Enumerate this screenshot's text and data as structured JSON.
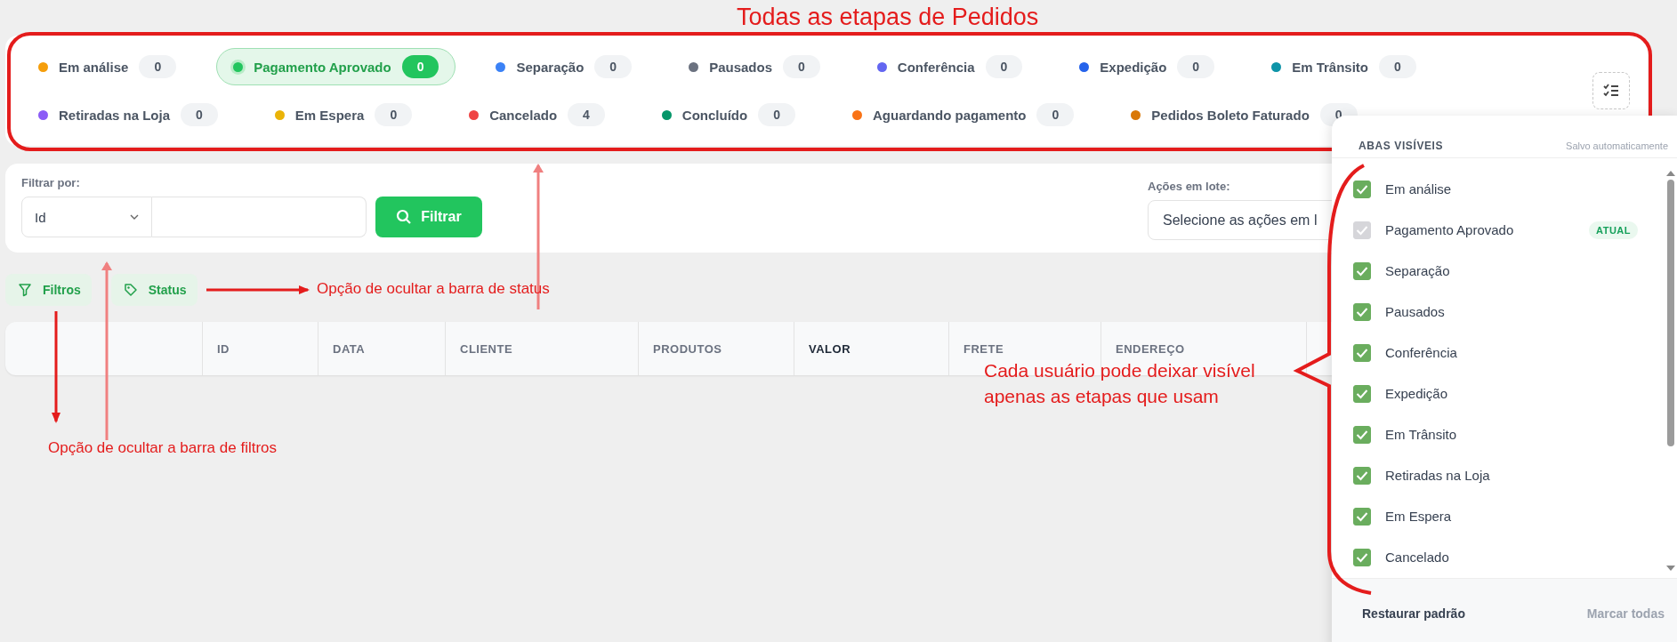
{
  "status_tabs": [
    {
      "label": "Em análise",
      "count": "0",
      "color": "#f59e0b",
      "selected": false
    },
    {
      "label": "Pagamento Aprovado",
      "count": "0",
      "color": "#22c55e",
      "selected": true
    },
    {
      "label": "Separação",
      "count": "0",
      "color": "#3b82f6",
      "selected": false
    },
    {
      "label": "Pausados",
      "count": "0",
      "color": "#6b7280",
      "selected": false
    },
    {
      "label": "Conferência",
      "count": "0",
      "color": "#6366f1",
      "selected": false
    },
    {
      "label": "Expedição",
      "count": "0",
      "color": "#2563eb",
      "selected": false
    },
    {
      "label": "Em Trânsito",
      "count": "0",
      "color": "#0e94a8",
      "selected": false
    },
    {
      "label": "Retiradas na Loja",
      "count": "0",
      "color": "#8b5cf6",
      "selected": false
    },
    {
      "label": "Em Espera",
      "count": "0",
      "color": "#eab308",
      "selected": false
    },
    {
      "label": "Cancelado",
      "count": "4",
      "color": "#ef4444",
      "selected": false
    },
    {
      "label": "Concluído",
      "count": "0",
      "color": "#059669",
      "selected": false
    },
    {
      "label": "Aguardando pagamento",
      "count": "0",
      "color": "#f97316",
      "selected": false
    },
    {
      "label": "Pedidos Boleto Faturado",
      "count": "0",
      "color": "#d97706",
      "selected": false
    }
  ],
  "filter": {
    "label": "Filtrar por:",
    "field_select": "Id",
    "button": "Filtrar",
    "bulk_label": "Ações em lote:",
    "bulk_select": "Selecione as ações em l"
  },
  "toggles": [
    {
      "kind": "filter",
      "label": "Filtros"
    },
    {
      "kind": "tag",
      "label": "Status"
    }
  ],
  "table": {
    "columns": [
      {
        "label": "ID",
        "sorted": false
      },
      {
        "label": "DATA",
        "sorted": false
      },
      {
        "label": "CLIENTE",
        "sorted": false
      },
      {
        "label": "PRODUTOS",
        "sorted": false
      },
      {
        "label": "VALOR",
        "sorted": true
      },
      {
        "label": "FRETE",
        "sorted": false
      },
      {
        "label": "ENDEREÇO",
        "sorted": false
      }
    ]
  },
  "visible_tabs_panel": {
    "title": "ABAS VISÍVEIS",
    "note": "Salvo automaticamente",
    "items": [
      {
        "label": "Em análise",
        "checked": true,
        "disabled": false
      },
      {
        "label": "Pagamento Aprovado",
        "checked": true,
        "disabled": true,
        "badge": "ATUAL"
      },
      {
        "label": "Separação",
        "checked": true,
        "disabled": false
      },
      {
        "label": "Pausados",
        "checked": true,
        "disabled": false
      },
      {
        "label": "Conferência",
        "checked": true,
        "disabled": false
      },
      {
        "label": "Expedição",
        "checked": true,
        "disabled": false
      },
      {
        "label": "Em Trânsito",
        "checked": true,
        "disabled": false
      },
      {
        "label": "Retiradas na Loja",
        "checked": true,
        "disabled": false
      },
      {
        "label": "Em Espera",
        "checked": true,
        "disabled": false
      },
      {
        "label": "Cancelado",
        "checked": true,
        "disabled": false
      }
    ],
    "restore": {
      "label": "Restaurar padrão",
      "disabled": false
    },
    "mark_all": {
      "label": "Marcar todas",
      "disabled": true
    }
  },
  "annotations": {
    "title": "Todas as etapas de Pedidos",
    "status_note": "Opção de ocultar a barra de status",
    "filter_note": "Opção de ocultar a barra de filtros",
    "panel_note": "Cada usuário pode deixar visível apenas as etapas que usam"
  }
}
